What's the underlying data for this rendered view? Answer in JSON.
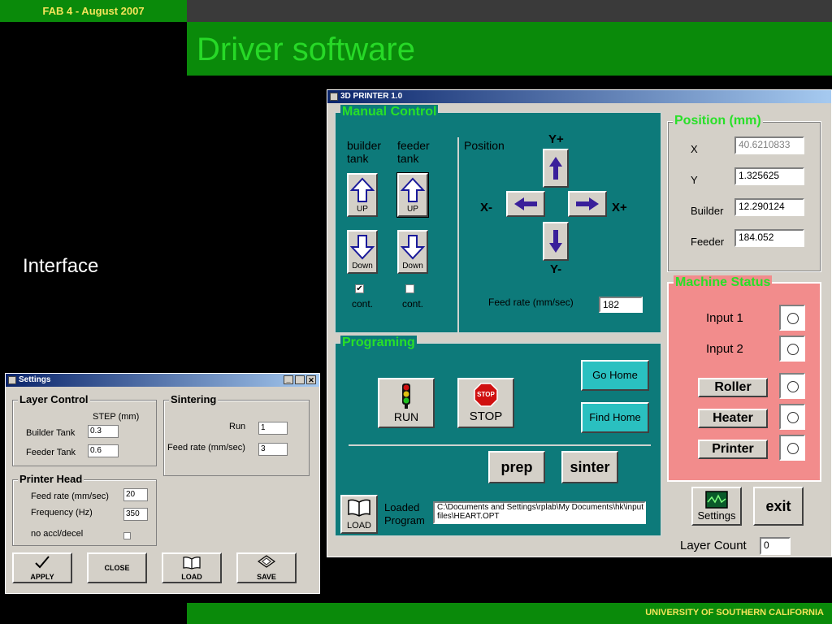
{
  "slide": {
    "header_tag": "FAB 4  - August 2007",
    "title": "Driver software",
    "bullet": "Interface",
    "footer": "UNIVERSITY OF SOUTHERN CALIFORNIA"
  },
  "main_window": {
    "title": "3D PRINTER 1.0",
    "manual_control": {
      "legend": "Manual Control",
      "builder_label": "builder tank",
      "feeder_label": "feeder tank",
      "up_label": "UP",
      "down_label": "Down",
      "cont_label": "cont.",
      "builder_cont_checked": "✔",
      "position_label": "Position",
      "y_plus": "Y+",
      "y_minus": "Y-",
      "x_minus": "X-",
      "x_plus": "X+",
      "feed_rate_label": "Feed rate (mm/sec)",
      "feed_rate_value": "182"
    },
    "position": {
      "legend": "Position (mm)",
      "x_label": "X",
      "x_value": "40.6210833",
      "y_label": "Y",
      "y_value": "1.325625",
      "builder_label": "Builder",
      "builder_value": "12.290124",
      "feeder_label": "Feeder",
      "feeder_value": "184.052"
    },
    "machine_status": {
      "legend": "Machine Status",
      "input1_label": "Input 1",
      "input2_label": "Input 2",
      "roller_label": "Roller",
      "heater_label": "Heater",
      "printer_label": "Printer"
    },
    "programing": {
      "legend": "Programing",
      "run_label": "RUN",
      "stop_label": "STOP",
      "stop_sign_text": "STOP",
      "go_home_label": "Go Home",
      "find_home_label": "Find Home",
      "prep_label": "prep",
      "sinter_label": "sinter",
      "load_label": "LOAD",
      "loaded_program_label": "Loaded Program",
      "program_path": "C:\\Documents and Settings\\rplab\\My Documents\\hk\\input files\\HEART.OPT"
    },
    "settings_label": "Settings",
    "exit_label": "exit",
    "layer_count_label": "Layer Count",
    "layer_count_value": "0"
  },
  "settings_window": {
    "title": "Settings",
    "layer_control": {
      "legend": "Layer Control",
      "step_label": "STEP (mm)",
      "builder_tank_label": "Builder Tank",
      "builder_tank_value": "0.3",
      "feeder_tank_label": "Feeder Tank",
      "feeder_tank_value": "0.6"
    },
    "sintering": {
      "legend": "Sintering",
      "run_label": "Run",
      "run_value": "1",
      "feed_rate_label": "Feed rate (mm/sec)",
      "feed_rate_value": "3"
    },
    "printer_head": {
      "legend": "Printer Head",
      "feed_rate_label": "Feed rate (mm/sec)",
      "feed_rate_value": "20",
      "frequency_label": "Frequency (Hz)",
      "frequency_value": "350",
      "no_accl_label": "no accl/decel"
    },
    "apply_label": "APPLY",
    "close_label": "CLOSE",
    "load_label": "LOAD",
    "save_label": "SAVE"
  },
  "colors": {
    "slide_green": "#0a8a0a",
    "title_green": "#27d927",
    "tag_yellow": "#f4e45a",
    "panel_teal": "#0d7a7a",
    "status_pink": "#f28c8c",
    "arrow_purple": "#3a1f9a"
  }
}
